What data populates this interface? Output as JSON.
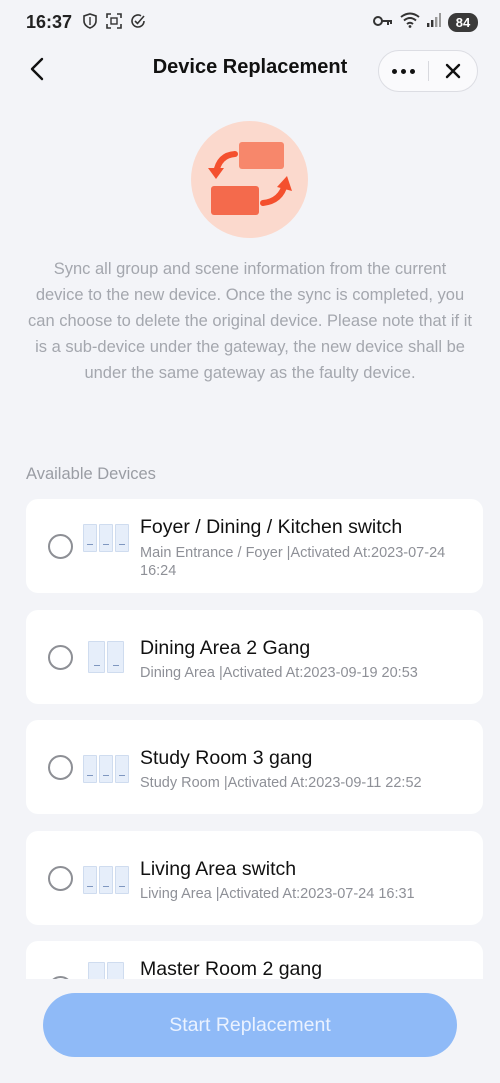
{
  "status_bar": {
    "time": "16:37",
    "battery": "84",
    "left_icons": [
      "shield-icon",
      "scan-icon",
      "check-circle-icon"
    ],
    "right_icons": [
      "key-icon",
      "wifi-icon",
      "signal-icon"
    ]
  },
  "header": {
    "title": "Device Replacement"
  },
  "description": "Sync all group and scene information from the current device to the new device. Once the sync is completed, you can choose to delete the original device. Please note that if it is a sub-device under the gateway, the new device shall be under the same gateway as the faulty device.",
  "section_title": "Available Devices",
  "devices": [
    {
      "name": "Foyer / Dining / Kitchen switch",
      "meta": "Main Entrance / Foyer |Activated At:2023-07-24 16:24",
      "gangs": 3
    },
    {
      "name": "Dining Area 2 Gang",
      "meta": "Dining Area |Activated At:2023-09-19 20:53",
      "gangs": 2
    },
    {
      "name": "Study Room 3 gang",
      "meta": "Study Room |Activated At:2023-09-11 22:52",
      "gangs": 3
    },
    {
      "name": "Living Area switch",
      "meta": "Living Area |Activated At:2023-07-24 16:31",
      "gangs": 3
    },
    {
      "name": "Master Room 2 gang",
      "meta": "",
      "gangs": 2
    }
  ],
  "button_label": "Start Replacement",
  "colors": {
    "background": "#f3f4f8",
    "accent_button": "#8fbaf7",
    "hero_circle": "#fbd9cd",
    "hero_icon": "#f46a4c"
  }
}
